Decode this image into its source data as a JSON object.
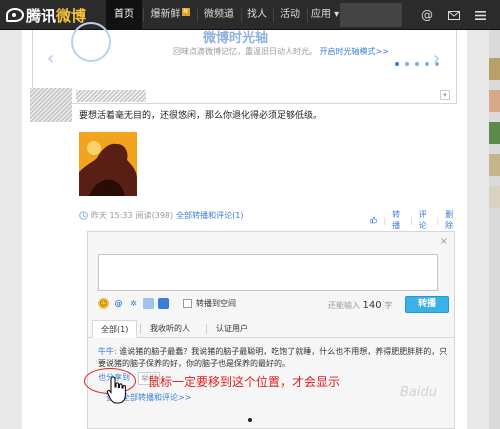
{
  "topnav": {
    "logo_part1": "腾讯",
    "logo_part2": "微博",
    "items": [
      {
        "label": "首页"
      },
      {
        "label": "爆新鲜"
      },
      {
        "label": "微频道"
      },
      {
        "label": "找人"
      },
      {
        "label": "活动"
      },
      {
        "label": "应用 ▾"
      }
    ],
    "hot_badge": "N"
  },
  "banner": {
    "headline": "微博时光轴",
    "sub_text": "回味点滴微博记忆，重温旧日动人时光。",
    "sub_link": "开启时光轴模式>>",
    "left_arrow": "‹",
    "right_arrow": "›",
    "dots": 5,
    "active_dot": 0
  },
  "post": {
    "text": "要想活着毫无目的，还很悠闲，那么你退化得必须足够低级。",
    "time": "昨天 15:33",
    "reads": "阅读(398)",
    "all_comments": "全部转播和评论(1)",
    "actions": [
      "转播",
      "评论",
      "删除"
    ],
    "menu": "▾"
  },
  "comment_box": {
    "close": "×",
    "share_label": "转播到空间",
    "counter_prefix": "还能输入",
    "counter_num": "140",
    "counter_suffix": "字",
    "submit": "转播",
    "tabs": [
      "全部(1)",
      "我收听的人",
      "认证用户"
    ],
    "comment_author": "牛牛:",
    "comment_text": "谁说猪的脑子最蠢？我说猪的脑子最聪明，吃饱了就睡，什么也不用想，养得肥肥胖胖的，只要说猪的脑子保养的好，你的脑子也是保养的最好的。",
    "comment_actions": [
      "也分享到",
      "举报"
    ],
    "view_all": "查看全部转播和评论>>"
  },
  "annotation": {
    "text": "鼠标一定要移到这个位置，才会显示"
  },
  "watermark": "Baidu",
  "colors": {
    "nav_bg": "#2b2b2b",
    "link": "#3b7ed8",
    "submit": "#3bb1e8",
    "annotation": "#e02020"
  }
}
